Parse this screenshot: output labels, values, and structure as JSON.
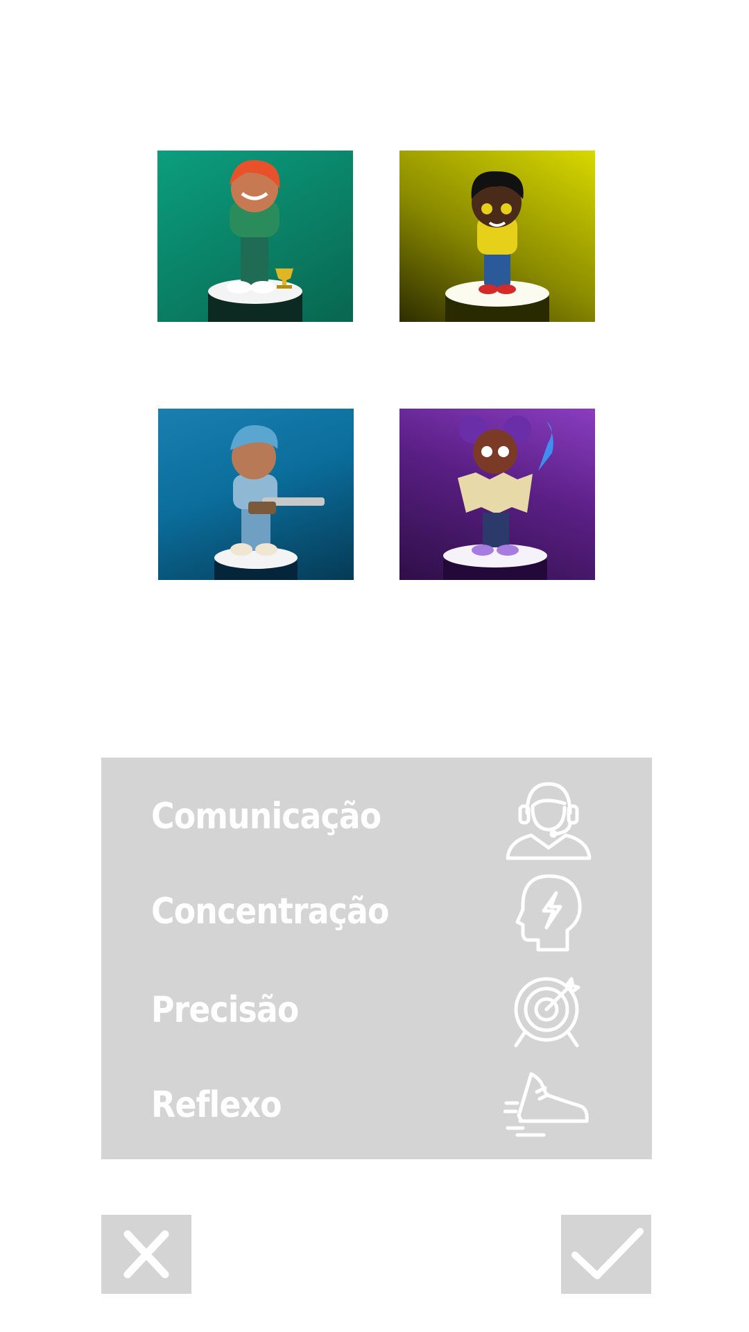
{
  "characters": [
    {
      "name": "character-card-green",
      "theme_color": "#0a8f70"
    },
    {
      "name": "character-card-yellow",
      "theme_color": "#c2c200"
    },
    {
      "name": "character-card-blue",
      "theme_color": "#0b6e9c"
    },
    {
      "name": "character-card-purple",
      "theme_color": "#5a1f85"
    }
  ],
  "skills": {
    "items": [
      {
        "label": "Comunicação",
        "icon": "headset-user-icon"
      },
      {
        "label": "Concentração",
        "icon": "head-lightning-icon"
      },
      {
        "label": "Precisão",
        "icon": "target-icon"
      },
      {
        "label": "Reflexo",
        "icon": "running-shoe-icon"
      }
    ]
  },
  "actions": {
    "cancel_icon": "close-icon",
    "confirm_icon": "check-icon"
  },
  "colors": {
    "panel": "#d4d4d4",
    "text": "#ffffff",
    "background": "#ffffff"
  }
}
